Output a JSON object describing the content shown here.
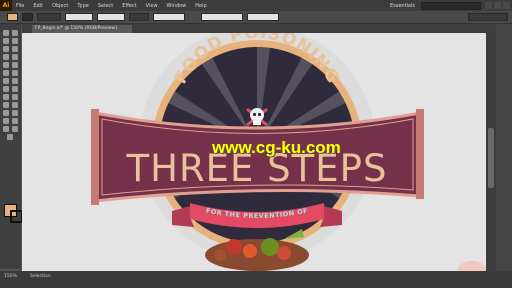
{
  "app": {
    "logo": "Ai",
    "workspace": "Essentials"
  },
  "menubar": {
    "items": [
      "File",
      "Edit",
      "Object",
      "Type",
      "Select",
      "Effect",
      "View",
      "Window",
      "Help"
    ]
  },
  "controlbar": {
    "fill_color": "#e8b27d",
    "stroke_color": "#2b2b2b"
  },
  "document": {
    "tab_label": "FP_Begin.ai* @ 150% (RGB/Preview)"
  },
  "artwork": {
    "top_text": "FOOD POISONING",
    "main_title": "THREE STEPS",
    "ribbon_text": "FOR THE PREVENTION OF",
    "colors": {
      "badge": "#2f2a3c",
      "badge_ring": "#e8b27d",
      "banner": "#75304a",
      "banner_border": "#e0a090",
      "banner_text": "#e8c39a",
      "ribbon": "#e24a66",
      "ribbon_text": "#a8e0d4"
    }
  },
  "watermark": {
    "text": "www.cg-ku.com"
  },
  "toolbar": {
    "fill_color": "#e8b27d",
    "stroke_color": "#111111"
  },
  "statusbar": {
    "zoom": "150%",
    "selection": "Selection"
  },
  "icons": [
    "menu-logo",
    "select-tool-icon",
    "direct-select-tool-icon",
    "magic-wand-icon",
    "lasso-icon",
    "pen-icon",
    "type-icon",
    "line-icon",
    "rectangle-icon",
    "brush-icon",
    "pencil-icon",
    "eraser-icon",
    "rotate-icon",
    "scale-icon",
    "width-icon",
    "free-transform-icon",
    "shape-builder-icon",
    "perspective-icon",
    "mesh-icon",
    "gradient-icon",
    "eyedropper-icon",
    "blend-icon",
    "symbol-sprayer-icon",
    "graph-icon",
    "artboard-icon",
    "slice-icon",
    "hand-icon",
    "zoom-icon",
    "skull-icon"
  ]
}
